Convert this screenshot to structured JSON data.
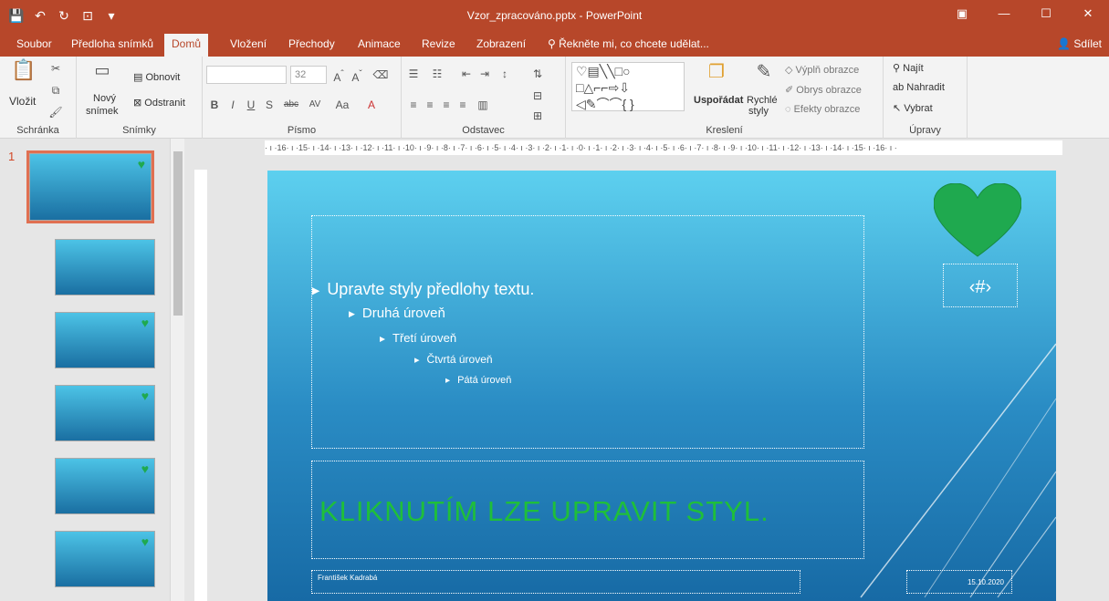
{
  "window": {
    "title": "Vzor_zpracováno.pptx - PowerPoint",
    "minimize": "—",
    "restore": "☐",
    "close": "✕"
  },
  "tabs": [
    {
      "label": "Soubor"
    },
    {
      "label": "Předloha snímků"
    },
    {
      "label": "Domů"
    },
    {
      "label": "Vložení"
    },
    {
      "label": "Přechody"
    },
    {
      "label": "Animace"
    },
    {
      "label": "Revize"
    },
    {
      "label": "Zobrazení"
    }
  ],
  "tell_me": "Řekněte mi, co chcete udělat...",
  "share": "Sdílet",
  "ribbon": {
    "clipboard": {
      "paste": "Vložit",
      "label": "Schránka"
    },
    "slides": {
      "new_slide_1": "Nový",
      "new_slide_2": "snímek",
      "reset": "Obnovit",
      "delete": "Odstranit",
      "label": "Snímky"
    },
    "font": {
      "size": "32",
      "label": "Písmo",
      "bold": "B",
      "italic": "I",
      "underline": "U",
      "shadow": "S",
      "strike": "abc",
      "case": "Aa"
    },
    "paragraph": {
      "label": "Odstavec"
    },
    "drawing": {
      "arrange": "Uspořádat",
      "quick_styles_1": "Rychlé",
      "quick_styles_2": "styly",
      "fill": "Výplň obrazce",
      "outline": "Obrys obrazce",
      "effects": "Efekty obrazce",
      "label": "Kreslení"
    },
    "editing": {
      "find": "Najít",
      "replace": "Nahradit",
      "select": "Vybrat",
      "label": "Úpravy"
    }
  },
  "thumbs": {
    "first_number": "1"
  },
  "ruler": {
    "h_ticks": "· ı ·16· ı ·15· ı ·14· ı ·13· ı ·12· ı ·11· ı ·10· ı ·9· ı ·8· ı ·7· ı ·6· ı ·5· ı ·4· ı ·3· ı ·2· ı ·1· ı ·0· ı ·1· ı ·2· ı ·3· ı ·4· ı ·5· ı ·6· ı ·7· ı ·8· ı ·9· ı ·10· ı ·11· ı ·12· ı ·13· ı ·14· ı ·15· ı ·16· ı ·"
  },
  "slide": {
    "levels": [
      "Upravte styly předlohy textu.",
      "Druhá úroveň",
      "Třetí úroveň",
      "Čtvrtá úroveň",
      "Pátá úroveň"
    ],
    "title": "KLIKNUTÍM LZE UPRAVIT STYL.",
    "slide_number": "‹#›",
    "footer": "František Kadrabá",
    "date": "15.10.2020",
    "heart_color": "#1fa94f"
  },
  "colors": {
    "accent": "#b7472a"
  }
}
